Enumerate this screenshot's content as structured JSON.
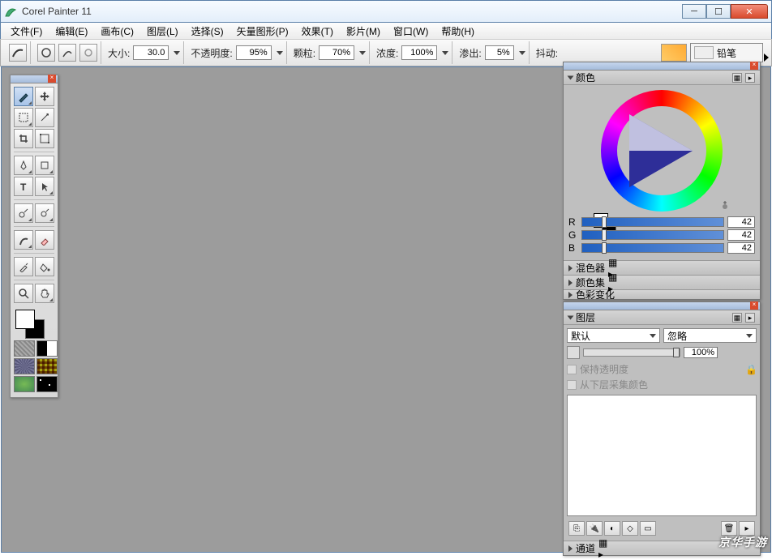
{
  "titlebar": {
    "title": "Corel Painter 11"
  },
  "menu": {
    "file": "文件(F)",
    "edit": "编辑(E)",
    "canvas": "画布(C)",
    "layer": "图层(L)",
    "select": "选择(S)",
    "shape": "矢量图形(P)",
    "effect": "效果(T)",
    "movie": "影片(M)",
    "window": "窗口(W)",
    "help": "帮助(H)"
  },
  "options": {
    "size_label": "大小:",
    "size": "30.0",
    "opacity_label": "不透明度:",
    "opacity": "95%",
    "grain_label": "颗粒:",
    "grain": "70%",
    "density_label": "浓度:",
    "density": "100%",
    "bleed_label": "渗出:",
    "bleed": "5%",
    "jitter_label": "抖动:",
    "brush_category": "铅笔"
  },
  "panels": {
    "color": {
      "title": "颜色",
      "r_label": "R",
      "g_label": "G",
      "b_label": "B",
      "r": "42",
      "g": "42",
      "b": "42"
    },
    "mixer": "混色器",
    "colorset": "颜色集",
    "colorvar": "色彩变化",
    "layers": {
      "title": "图层",
      "blend_default": "默认",
      "blend_ignore": "忽略",
      "opacity": "100%",
      "preserve": "保持透明度",
      "pickup": "从下层采集颜色"
    },
    "channels": "通道"
  },
  "watermark": "京华手游"
}
